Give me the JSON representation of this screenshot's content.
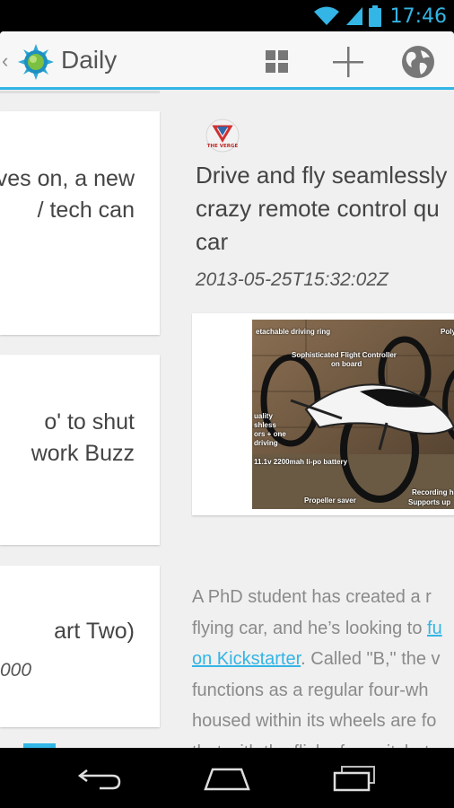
{
  "status_bar": {
    "time": "17:46"
  },
  "action_bar": {
    "title": "Daily"
  },
  "cards": [
    {
      "lines": [
        "ves on, a new",
        "/ tech can"
      ]
    },
    {
      "lines": [
        "o' to shut",
        "work Buzz"
      ]
    },
    {
      "lines": [
        "art Two)"
      ],
      "sub": "000"
    }
  ],
  "article": {
    "source_logo_text": "THE VERGE",
    "title_lines": [
      "Drive and fly seamlessly",
      "crazy remote control qu",
      "car"
    ],
    "date": "2013-05-25T15:32:02Z",
    "image_labels": {
      "l1": "etachable driving ring",
      "l2": "Sophisticated Flight Controller",
      "l2b": "on board",
      "l3": "Polyc",
      "l4": "uality",
      "l5": "shless",
      "l6": "ors + one",
      "l7": "driving",
      "l8": "11.1v 2200mah li-po battery",
      "l9": "Propeller saver",
      "l10": "H",
      "l11": "Recording h",
      "l12": "Supports up"
    },
    "body": {
      "l1": "A PhD student has created a r",
      "l2_pre": "flying car, and he’s looking to ",
      "l2_link": "fu",
      "l3_link": "on Kickstarter",
      "l3_post": ". Called \"B,\" the v",
      "l4": "functions as a regular four-wh",
      "l5": "housed within its wheels are fo",
      "l6": "that with the flick of a switch, t"
    }
  },
  "colors": {
    "accent": "#33b5e5",
    "background": "#f0f0f0"
  }
}
